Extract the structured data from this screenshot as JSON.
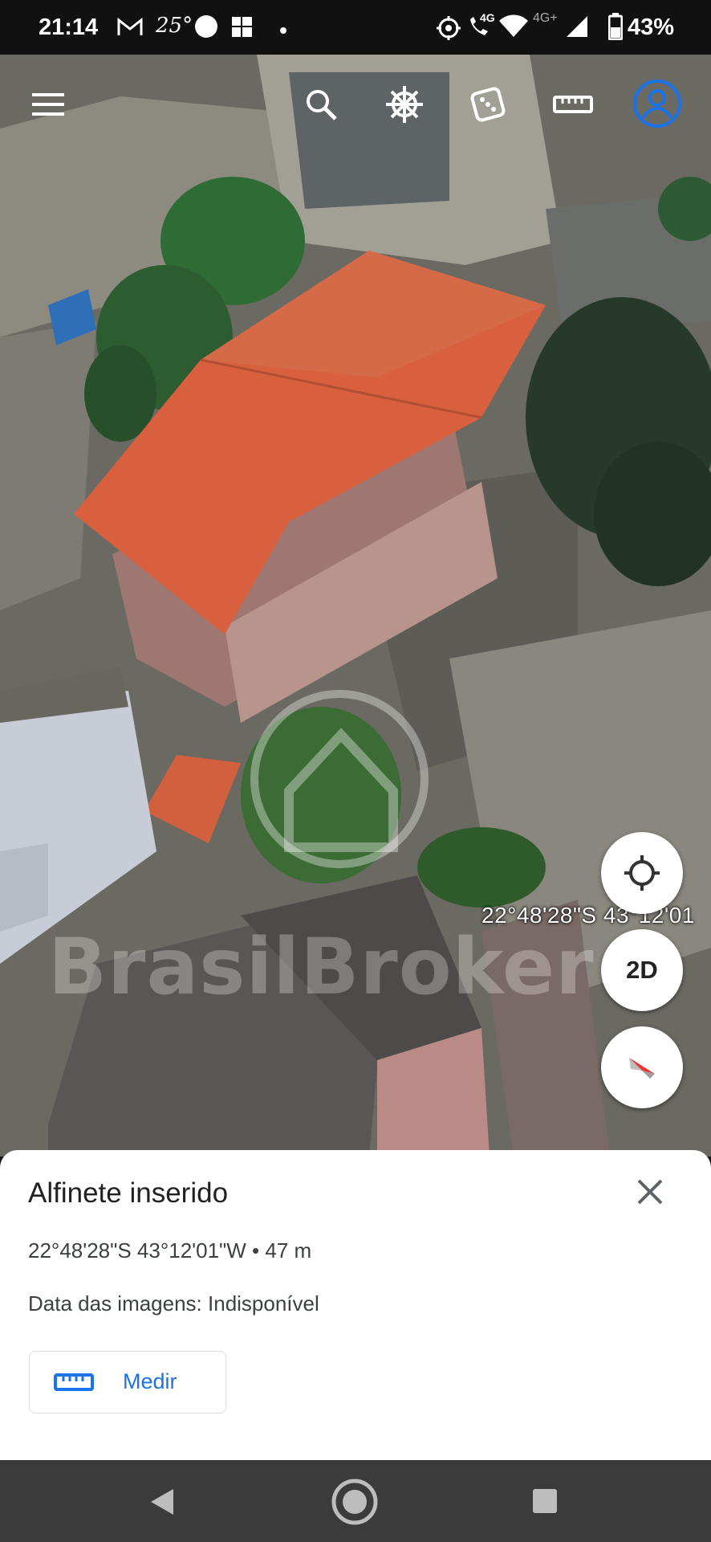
{
  "status_bar": {
    "time": "21:14",
    "temperature": "25°",
    "network": "4G",
    "network_plus": "4G+",
    "battery": "43%"
  },
  "toolbar": {
    "icons": [
      "menu-icon",
      "search-icon",
      "voyager-wheel-icon",
      "feeling-lucky-dice-icon",
      "measure-ruler-icon",
      "account-icon"
    ]
  },
  "map": {
    "coordinate_overlay": "22°48'28\"S 43°12'01",
    "watermark": "BrasilBroker",
    "buttons": {
      "locate": "my-location-icon",
      "view_mode": "2D",
      "compass": "compass-icon"
    }
  },
  "pin_sheet": {
    "title": "Alfinete inserido",
    "coordinates": "22°48'28\"S 43°12'01\"W • 47 m",
    "imagery_date": "Data das imagens: Indisponível",
    "measure_button": "Medir"
  },
  "navigation": {
    "icons": [
      "back-icon",
      "home-icon",
      "recents-icon"
    ]
  },
  "colors": {
    "accent": "#1a73e8",
    "account": "#1a73e8",
    "roof": "#d8603e",
    "sheet_bg": "#ffffff",
    "navbar_bg": "#3b3b3b"
  }
}
